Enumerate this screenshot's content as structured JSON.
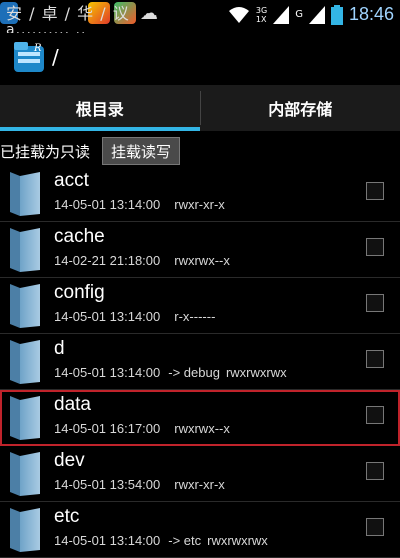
{
  "status": {
    "time": "18:46",
    "network_top": "3G",
    "network_bottom": "1X",
    "signal_label": "G",
    "garbled_line1": "安 / 卓 / 华 / 议",
    "garbled_line2": "a.......... .."
  },
  "title": {
    "path": "/"
  },
  "tabs": [
    {
      "label": "根目录",
      "active": true
    },
    {
      "label": "内部存储",
      "active": false
    }
  ],
  "mount": {
    "status_text": "已挂载为只读",
    "button_label": "挂载读写"
  },
  "files": [
    {
      "name": "acct",
      "date": "14-05-01 13:14:00",
      "link": "",
      "perm": "rwxr-xr-x",
      "selected": false
    },
    {
      "name": "cache",
      "date": "14-02-21 21:18:00",
      "link": "",
      "perm": "rwxrwx--x",
      "selected": false
    },
    {
      "name": "config",
      "date": "14-05-01 13:14:00",
      "link": "",
      "perm": "r-x------",
      "selected": false
    },
    {
      "name": "d",
      "date": "14-05-01 13:14:00",
      "link": "-> debug",
      "perm": "rwxrwxrwx",
      "selected": false
    },
    {
      "name": "data",
      "date": "14-05-01 16:17:00",
      "link": "",
      "perm": "rwxrwx--x",
      "selected": true
    },
    {
      "name": "dev",
      "date": "14-05-01 13:54:00",
      "link": "",
      "perm": "rwxr-xr-x",
      "selected": false
    },
    {
      "name": "etc",
      "date": "14-05-01 13:14:00",
      "link": "-> etc",
      "perm": "rwxrwxrwx",
      "selected": false
    }
  ],
  "colors": {
    "accent": "#33b5e5",
    "selection": "#c0232b"
  }
}
